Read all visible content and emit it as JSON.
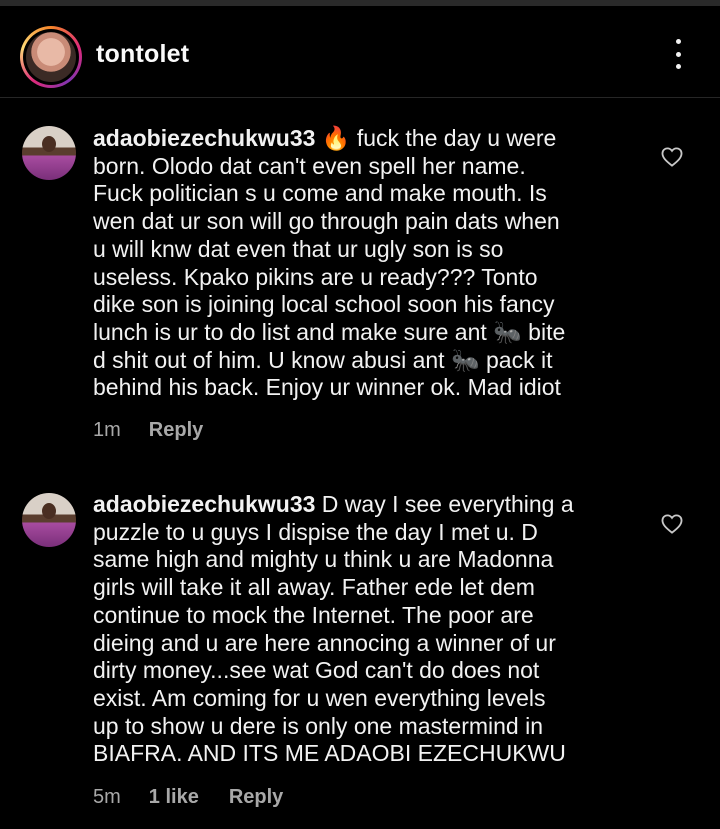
{
  "header": {
    "username": "tontolet",
    "more_icon": "more-vertical-icon"
  },
  "comments": [
    {
      "user": "adaobiezechukwu33",
      "emoji": "🔥",
      "text": " fuck the day u were\nborn. Olodo dat can't even spell her name.\nFuck politician s u come and make mouth. Is\nwen dat ur son will go through pain dats when\nu will knw dat even that ur ugly son is so\nuseless. Kpako pikins are u ready??? Tonto\ndike son is joining local school soon his fancy\nlunch is ur to do list and make sure ant 🐜 bite\nd shit out of him. U know abusi ant 🐜 pack it\nbehind his back. Enjoy ur winner ok. Mad idiot",
      "time": "1m",
      "likes": "",
      "reply": "Reply",
      "like_icon": "heart-outline-icon"
    },
    {
      "user": "adaobiezechukwu33",
      "emoji": "",
      "text": " D way I see everything a\npuzzle to u guys I dispise the day I met u. D\nsame high and mighty u think u are Madonna\ngirls will take it all away. Father ede let dem\ncontinue to mock the Internet. The poor are\ndieing and u are here annocing a winner of ur\ndirty money...see wat God can't do does not\nexist. Am coming for u wen everything levels\nup to show u dere is only one mastermind in\nBIAFRA. AND ITS ME ADAOBI EZECHUKWU",
      "time": "5m",
      "likes": "1 like",
      "reply": "Reply",
      "like_icon": "heart-outline-icon"
    }
  ]
}
